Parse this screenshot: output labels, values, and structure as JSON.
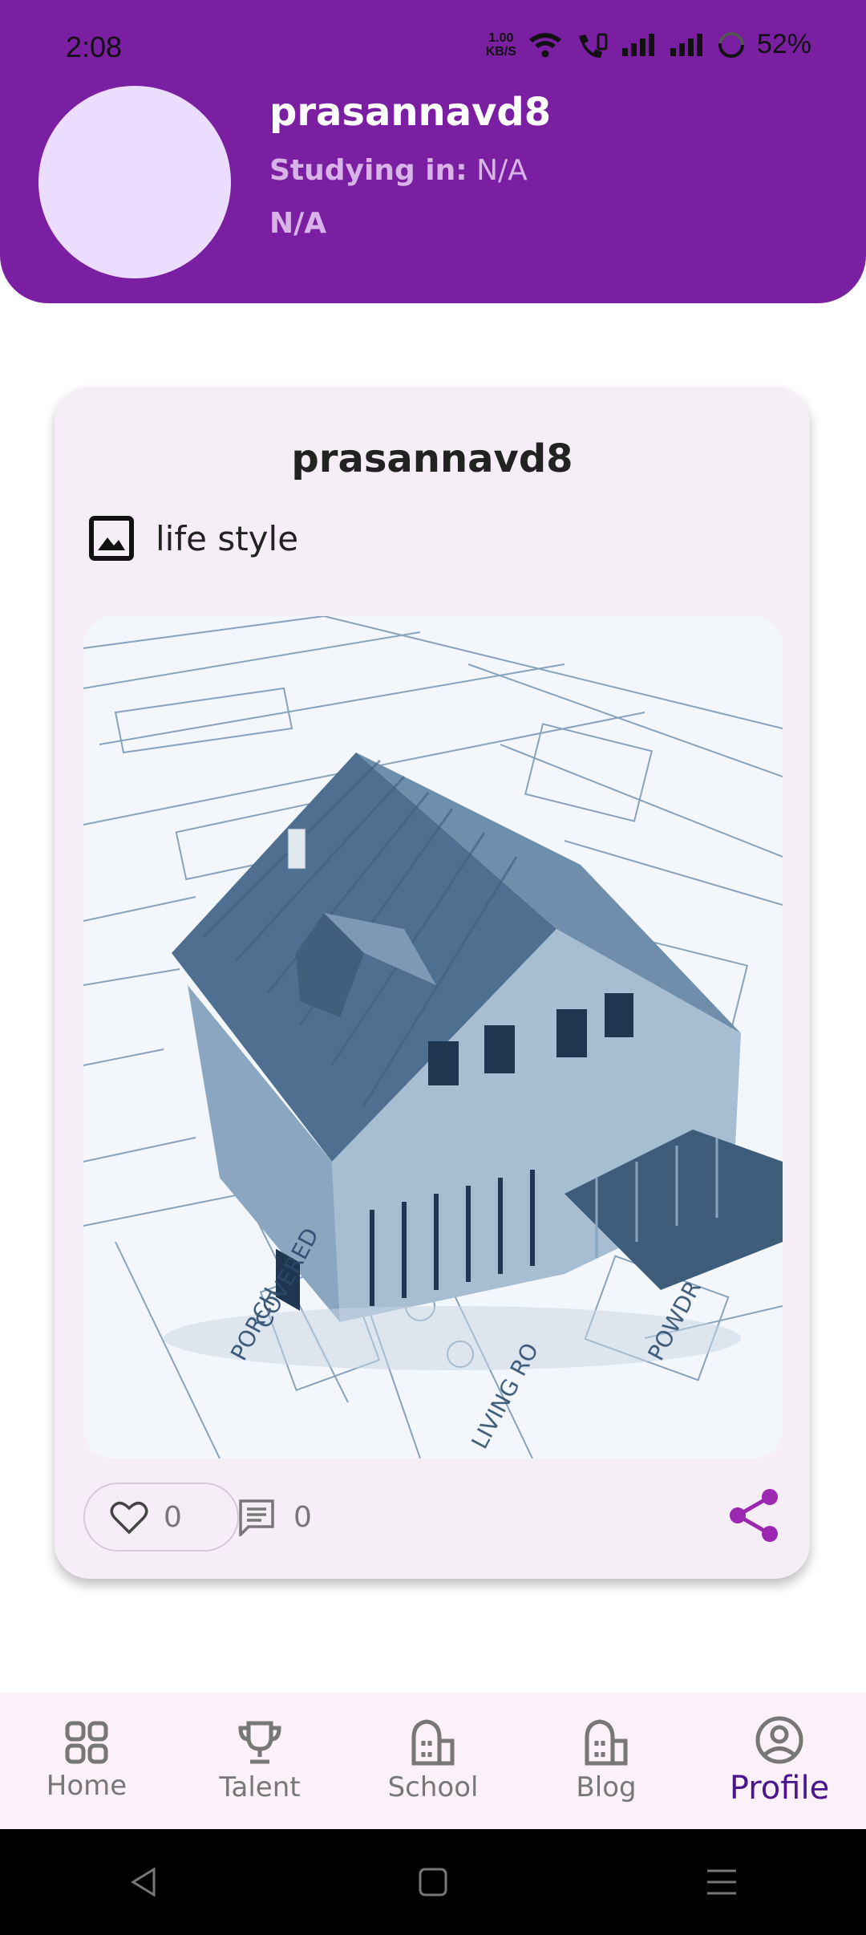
{
  "status_bar": {
    "time": "2:08",
    "net_speed_value": "1.00",
    "net_speed_unit": "KB/S",
    "battery": "52%"
  },
  "profile": {
    "username": "prasannavd8",
    "studying_label": "Studying in:",
    "studying_value": "N/A",
    "secondary": "N/A"
  },
  "post": {
    "author": "prasannavd8",
    "category": "life style",
    "likes": "0",
    "comments": "0"
  },
  "bottom_nav": {
    "items": [
      {
        "label": "Home",
        "icon": "grid-icon"
      },
      {
        "label": "Talent",
        "icon": "trophy-icon"
      },
      {
        "label": "School",
        "icon": "building-icon"
      },
      {
        "label": "Blog",
        "icon": "building-icon"
      },
      {
        "label": "Profile",
        "icon": "account-circle-icon"
      }
    ],
    "active": "Profile"
  },
  "colors": {
    "primary": "#7B1FA2",
    "avatar_bg": "#EADDFF",
    "card_bg": "#F6EEF7",
    "nav_bg": "#FCF1F8",
    "active_nav": "#4A148C",
    "share_color": "#9C27B0"
  }
}
